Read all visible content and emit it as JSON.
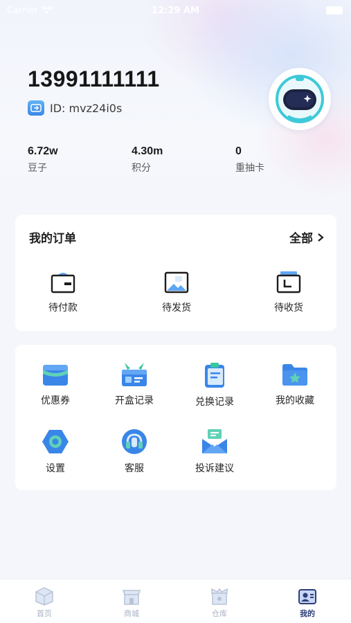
{
  "status_bar": {
    "carrier": "Carrier",
    "time": "12:29 AM"
  },
  "profile": {
    "phone": "13991111111",
    "id_text": "ID: mvz24i0s"
  },
  "stats": [
    {
      "value": "6.72w",
      "label": "豆子"
    },
    {
      "value": "4.30m",
      "label": "积分"
    },
    {
      "value": "0",
      "label": "重抽卡"
    }
  ],
  "orders": {
    "title": "我的订单",
    "all_label": "全部",
    "items": [
      {
        "label": "待付款",
        "icon": "wallet-icon"
      },
      {
        "label": "待发货",
        "icon": "package-icon"
      },
      {
        "label": "待收货",
        "icon": "receive-icon"
      }
    ]
  },
  "services": [
    {
      "label": "优惠券",
      "icon": "coupon-icon"
    },
    {
      "label": "开盒记录",
      "icon": "box-open-icon"
    },
    {
      "label": "兑换记录",
      "icon": "clipboard-icon"
    },
    {
      "label": "我的收藏",
      "icon": "folder-star-icon"
    },
    {
      "label": "设置",
      "icon": "gear-icon"
    },
    {
      "label": "客服",
      "icon": "headset-icon"
    },
    {
      "label": "投诉建议",
      "icon": "envelope-icon"
    }
  ],
  "tabs": [
    {
      "label": "首页",
      "icon": "home-box-icon",
      "active": false
    },
    {
      "label": "商城",
      "icon": "shop-icon",
      "active": false
    },
    {
      "label": "仓库",
      "icon": "warehouse-icon",
      "active": false
    },
    {
      "label": "我的",
      "icon": "profile-icon",
      "active": true
    }
  ],
  "colors": {
    "accent_blue": "#3a86e8",
    "accent_green": "#39c6a0",
    "tab_active": "#2d3f78",
    "tab_inactive": "#a8b1c4"
  }
}
